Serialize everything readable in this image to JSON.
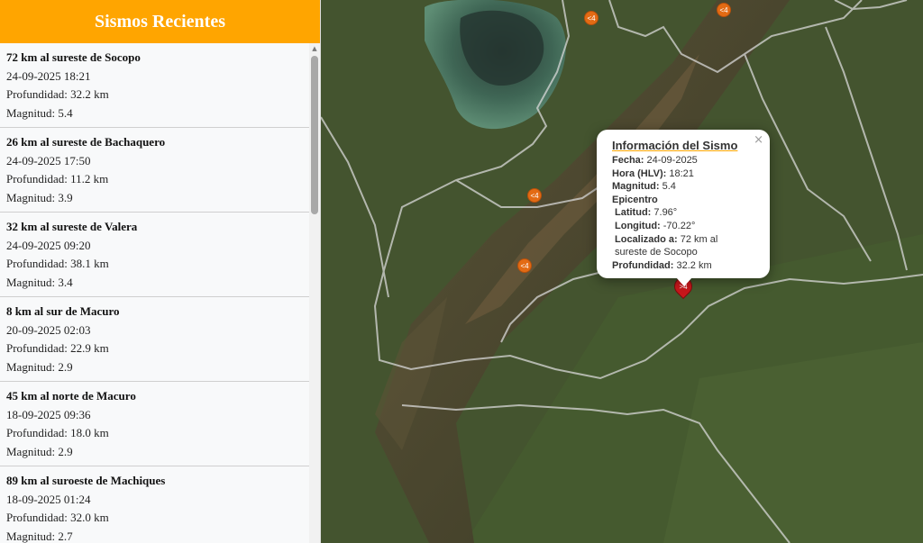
{
  "sidebar": {
    "title": "Sismos Recientes",
    "items": [
      {
        "location": "72 km al sureste de Socopo",
        "datetime": "24-09-2025 18:21",
        "depth": "Profundidad: 32.2 km",
        "magnitude": "Magnitud: 5.4"
      },
      {
        "location": "26 km al sureste de Bachaquero",
        "datetime": "24-09-2025 17:50",
        "depth": "Profundidad: 11.2 km",
        "magnitude": "Magnitud: 3.9"
      },
      {
        "location": "32 km al sureste de Valera",
        "datetime": "24-09-2025 09:20",
        "depth": "Profundidad: 38.1 km",
        "magnitude": "Magnitud: 3.4"
      },
      {
        "location": "8 km al sur de Macuro",
        "datetime": "20-09-2025 02:03",
        "depth": "Profundidad: 22.9 km",
        "magnitude": "Magnitud: 2.9"
      },
      {
        "location": "45 km al norte de Macuro",
        "datetime": "18-09-2025 09:36",
        "depth": "Profundidad: 18.0 km",
        "magnitude": "Magnitud: 2.9"
      },
      {
        "location": "89 km al suroeste de Machiques",
        "datetime": "18-09-2025 01:24",
        "depth": "Profundidad: 32.0 km",
        "magnitude": "Magnitud: 2.7"
      }
    ]
  },
  "map": {
    "markers": [
      {
        "label": "<4"
      },
      {
        "label": "<4"
      },
      {
        "label": "<4"
      },
      {
        "label": "<4"
      },
      {
        "label": ">4"
      }
    ],
    "popup": {
      "title": "Información del Sismo",
      "close": "×",
      "fecha_label": "Fecha:",
      "fecha": "24-09-2025",
      "hora_label": "Hora (HLV):",
      "hora": "18:21",
      "magnitud_label": "Magnitud:",
      "magnitud": "5.4",
      "epicentro_label": "Epicentro",
      "latitud_label": "Latitud:",
      "latitud": "7.96°",
      "longitud_label": "Longitud:",
      "longitud": "-70.22°",
      "localizado_label": "Localizado a:",
      "localizado": "72 km al sureste de Socopo",
      "profundidad_label": "Profundidad:",
      "profundidad": "32.2 km"
    }
  },
  "colors": {
    "accent": "#ffa500",
    "marker_small": "#e36b14",
    "marker_big": "#c8171b"
  }
}
